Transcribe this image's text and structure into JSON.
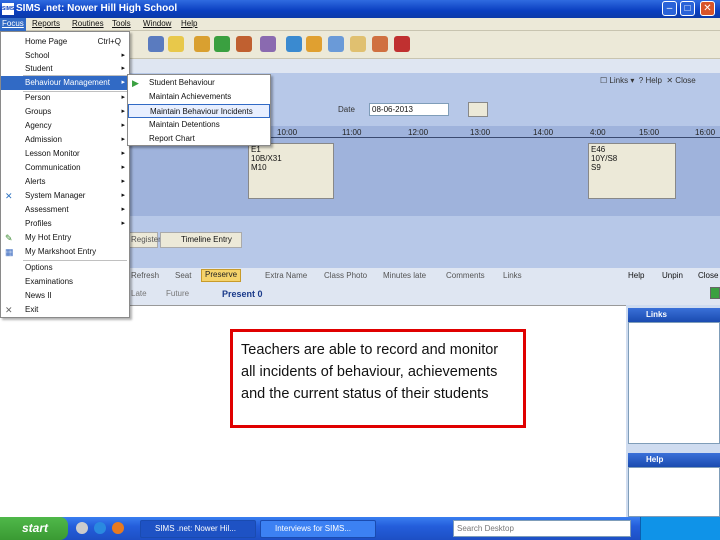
{
  "window": {
    "title": "SIMS .net: Nower Hill High School"
  },
  "menubar": {
    "items": [
      "Focus",
      "Reports",
      "Routines",
      "Tools",
      "Window",
      "Help"
    ]
  },
  "focus_menu": {
    "items": [
      {
        "label": "Home Page",
        "shortcut": "Ctrl+Q"
      },
      {
        "label": "School",
        "arrow": "▸"
      },
      {
        "label": "Student",
        "arrow": "▸"
      },
      {
        "label": "Behaviour Management",
        "arrow": "▸",
        "selected": true
      },
      {
        "label": "Person",
        "arrow": "▸"
      },
      {
        "label": "Groups",
        "arrow": "▸"
      },
      {
        "label": "Agency",
        "arrow": "▸"
      },
      {
        "label": "Admission",
        "arrow": "▸"
      },
      {
        "label": "Lesson Monitor",
        "arrow": "▸"
      },
      {
        "label": "Communication",
        "arrow": "▸"
      },
      {
        "label": "Alerts",
        "arrow": "▸"
      },
      {
        "label": "System Manager",
        "arrow": "▸"
      },
      {
        "label": "Assessment",
        "arrow": "▸"
      },
      {
        "label": "Profiles",
        "arrow": "▸"
      },
      {
        "label": "My Hot Entry"
      },
      {
        "label": "My Markshoot Entry"
      },
      {
        "label": "Options"
      },
      {
        "label": "Examinations"
      },
      {
        "label": "News II"
      },
      {
        "label": "Exit"
      }
    ]
  },
  "behaviour_submenu": {
    "items": [
      {
        "label": "Student Behaviour"
      },
      {
        "label": "Maintain Achievements"
      },
      {
        "label": "Maintain Behaviour Incidents",
        "selected": true
      },
      {
        "label": "Maintain Detentions"
      },
      {
        "label": "Report Chart"
      }
    ]
  },
  "top_right_tools": {
    "links": "Links",
    "help": "Help",
    "close": "Close"
  },
  "date": {
    "label": "Date",
    "value": "08-06-2013"
  },
  "timeline": {
    "ticks": [
      "10:00",
      "11:00",
      "12:00",
      "13:00",
      "14:00",
      "4:00",
      "15:00",
      "16:00"
    ],
    "periods": [
      {
        "lines": [
          "E1",
          "10B/X31",
          "M10"
        ]
      },
      {
        "lines": [
          "E46",
          "10Y/S8",
          "S9"
        ]
      }
    ]
  },
  "tabs": {
    "items": [
      "Register",
      "Timeline Entry"
    ]
  },
  "action_toolbar": {
    "items": [
      "Refresh",
      "Seat",
      "Preserve",
      "Extra Name",
      "Class Photo",
      "Minutes late",
      "Comments",
      "Links"
    ],
    "help": "Help",
    "unpin": "Unpin",
    "close": "Close"
  },
  "filters": {
    "items": [
      "Late",
      "Future"
    ],
    "present": "Present 0"
  },
  "right_panes": {
    "links": "Links",
    "help": "Help"
  },
  "callout": {
    "text": "Teachers are able to record and monitor all incidents of behaviour, achievements and the current status of their students"
  },
  "taskbar": {
    "start": "start",
    "tasks": [
      "SIMS .net: Nower Hil...",
      "Interviews for SIMS..."
    ],
    "search_placeholder": "Search Desktop"
  },
  "colors": {
    "titlebar": "#0a3fc0",
    "menu_selected": "#316ac5",
    "callout_border": "#e00000",
    "start_button": "#3a9a33"
  }
}
